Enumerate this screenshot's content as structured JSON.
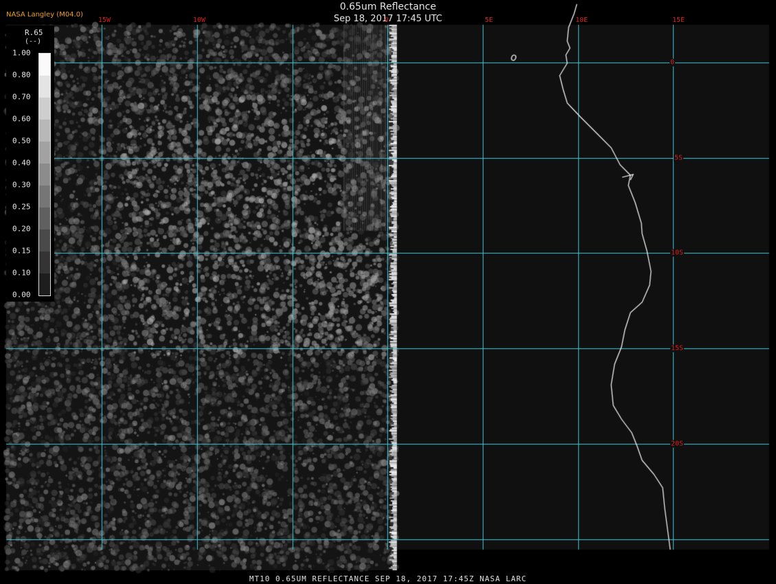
{
  "header": {
    "credit": "NASA Langley (M04.0)",
    "title": "0.65um Reflectance",
    "subtitle": "Sep 18, 2017 17:45 UTC"
  },
  "grid": {
    "longitudes": [
      {
        "label": "15W",
        "value": -15
      },
      {
        "label": "10W",
        "value": -10
      },
      {
        "label": "0",
        "value": 0
      },
      {
        "label": "5E",
        "value": 5
      },
      {
        "label": "10E",
        "value": 10
      },
      {
        "label": "15E",
        "value": 15
      }
    ],
    "latitudes": [
      {
        "label": "0",
        "value": 0
      },
      {
        "label": "5S",
        "value": -5
      },
      {
        "label": "10S",
        "value": -10
      },
      {
        "label": "15S",
        "value": -15
      },
      {
        "label": "20S",
        "value": -20
      }
    ]
  },
  "legend": {
    "variable": "R.65",
    "unit": "(--)",
    "ticks": [
      "1.00",
      "0.80",
      "0.70",
      "0.60",
      "0.50",
      "0.40",
      "0.30",
      "0.25",
      "0.20",
      "0.15",
      "0.10",
      "0.00"
    ]
  },
  "footer": "MT10  0.65UM REFLECTANCE   SEP 18, 2017 17:45Z   NASA LARC",
  "colors": {
    "gridline": "#40c8d8",
    "grid_label": "#d42020",
    "credit": "#f0a020",
    "coastline": "#ffffff",
    "background": "#101010"
  }
}
